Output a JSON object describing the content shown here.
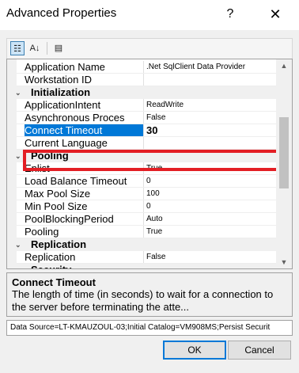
{
  "window": {
    "title": "Advanced Properties",
    "help_label": "?",
    "close_label": "✕"
  },
  "toolbar": {
    "categorized_label": "☷",
    "alphabetical_label": "A↓",
    "property_pages_label": "▤"
  },
  "properties": {
    "rows": [
      {
        "type": "prop",
        "name": "Application Name",
        "value": ".Net SqlClient Data Provider"
      },
      {
        "type": "prop",
        "name": "Workstation ID",
        "value": ""
      },
      {
        "type": "category",
        "name": "Initialization",
        "expander": "⌄"
      },
      {
        "type": "prop",
        "name": "ApplicationIntent",
        "value": "ReadWrite"
      },
      {
        "type": "prop",
        "name": "Asynchronous Proces",
        "value": "False"
      },
      {
        "type": "prop",
        "name": "Connect Timeout",
        "value": "30",
        "selected": true
      },
      {
        "type": "prop",
        "name": "Current Language",
        "value": ""
      },
      {
        "type": "category",
        "name": "Pooling",
        "expander": "⌄"
      },
      {
        "type": "prop",
        "name": "Enlist",
        "value": "True"
      },
      {
        "type": "prop",
        "name": "Load Balance Timeout",
        "value": "0"
      },
      {
        "type": "prop",
        "name": "Max Pool Size",
        "value": "100"
      },
      {
        "type": "prop",
        "name": "Min Pool Size",
        "value": "0"
      },
      {
        "type": "prop",
        "name": "PoolBlockingPeriod",
        "value": "Auto"
      },
      {
        "type": "prop",
        "name": "Pooling",
        "value": "True"
      },
      {
        "type": "category",
        "name": "Replication",
        "expander": "⌄"
      },
      {
        "type": "prop",
        "name": "Replication",
        "value": "False"
      },
      {
        "type": "category",
        "name": "Security",
        "expander": "⌄"
      }
    ]
  },
  "scrollbar": {
    "up_label": "▲",
    "down_label": "▼",
    "scroll_position": 0.4
  },
  "description": {
    "title": "Connect Timeout",
    "text": "The length of time (in seconds) to wait for a connection to the server before terminating the atte..."
  },
  "connection_string": "Data Source=LT-KMAUZOUL-03;Initial Catalog=VM908MS;Persist Securit",
  "buttons": {
    "ok": "OK",
    "cancel": "Cancel"
  },
  "colors": {
    "selection": "#0078d7",
    "highlight_box": "#e31e24"
  }
}
